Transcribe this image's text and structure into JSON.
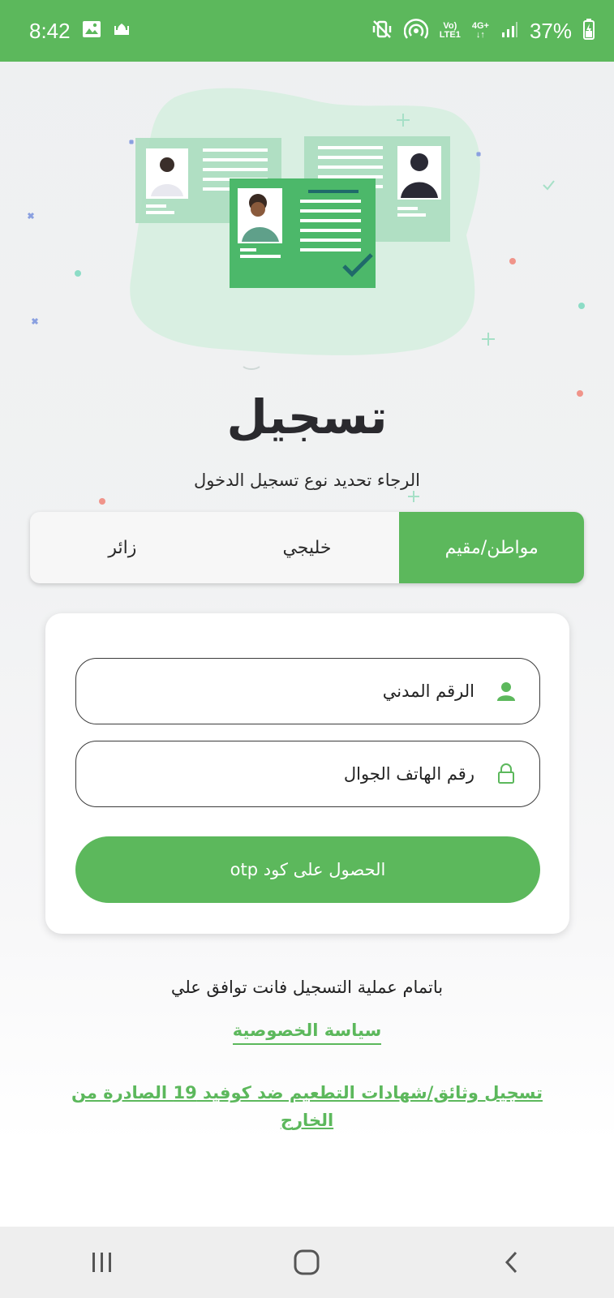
{
  "status_bar": {
    "time": "8:42",
    "battery_percent": "37%",
    "network_top": "Vo)",
    "network_bottom": "LTE1",
    "network_gen": "4G+"
  },
  "header": {
    "title": "تسجيل",
    "subtitle": "الرجاء تحديد نوع تسجيل الدخول"
  },
  "tabs": [
    {
      "label": "مواطن/مقيم",
      "active": true
    },
    {
      "label": "خليجي",
      "active": false
    },
    {
      "label": "زائر",
      "active": false
    }
  ],
  "form": {
    "civil_id_placeholder": "الرقم المدني",
    "phone_placeholder": "رقم الهاتف الجوال",
    "submit_label": "الحصول على كود otp"
  },
  "footer": {
    "agree_text": "باتمام عملية التسجيل فانت توافق علي",
    "privacy_link": "سياسة الخصوصية",
    "vaccine_link": "تسجيل وثائق/شهادات التطعيم ضد كوفيد 19 الصادرة من الخارج"
  },
  "colors": {
    "accent": "#5cb85c",
    "status_bar": "#5cb85c",
    "illustration_blob": "#d9efe2"
  },
  "icons": {
    "civil_id": "user-icon",
    "phone": "lock-icon",
    "nav_recent": "recent-apps-icon",
    "nav_home": "home-icon",
    "nav_back": "back-icon"
  }
}
